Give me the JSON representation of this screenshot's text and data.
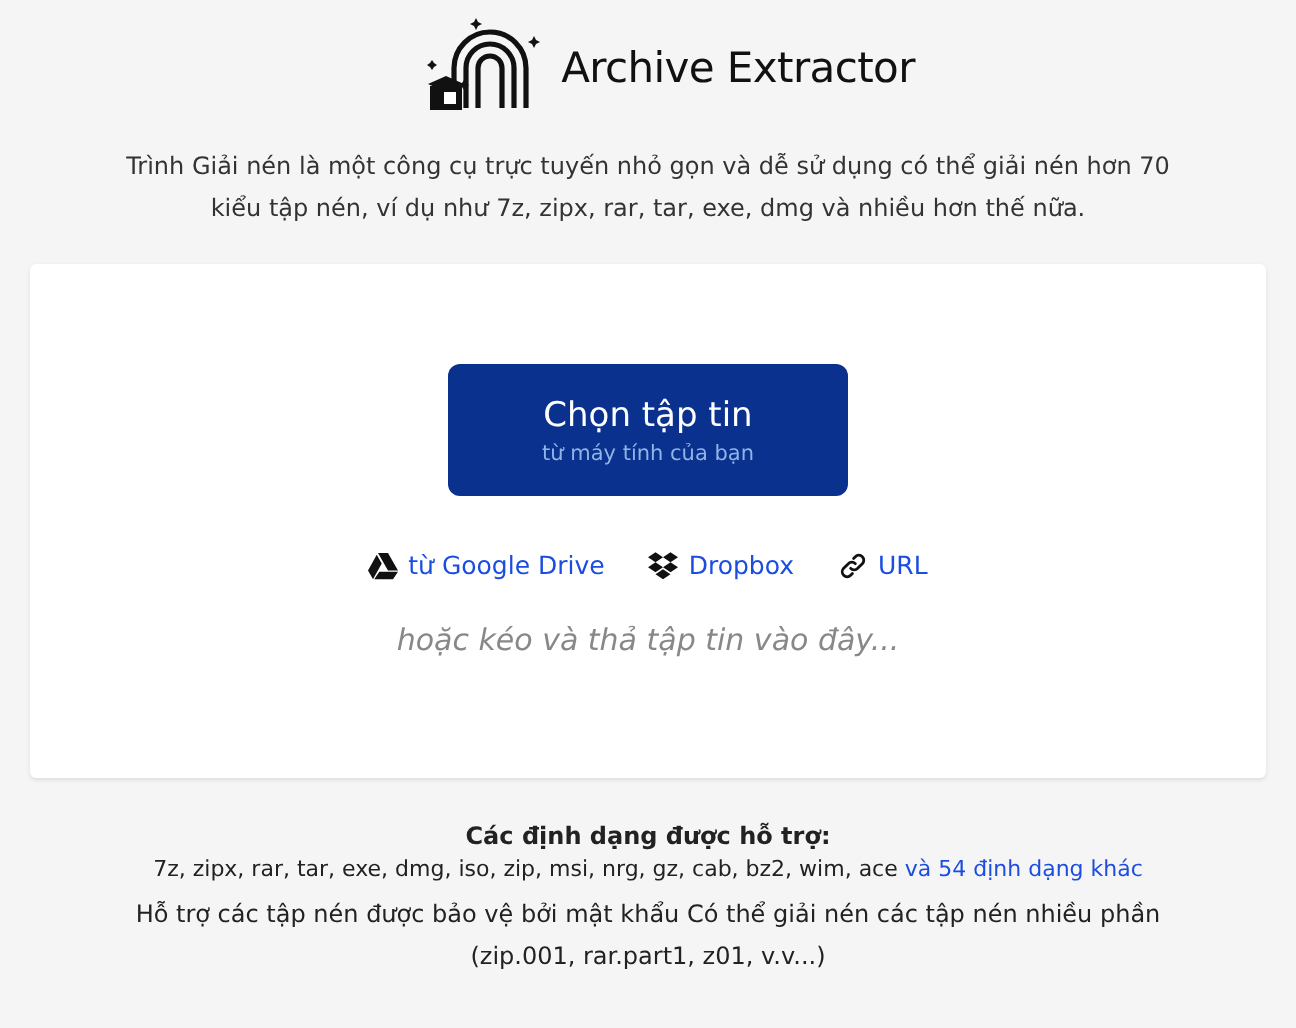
{
  "header": {
    "title": "Archive Extractor",
    "description": "Trình Giải nén là một công cụ trực tuyến nhỏ gọn và dễ sử dụng có thể giải nén hơn 70 kiểu tập nén, ví dụ như 7z, zipx, rar, tar, exe, dmg và nhiều hơn thế nữa."
  },
  "upload": {
    "button": {
      "label": "Chọn tập tin",
      "sublabel": "từ máy tính của bạn"
    },
    "sources": [
      {
        "kind": "drive",
        "label": "từ Google Drive"
      },
      {
        "kind": "dropbox",
        "label": "Dropbox"
      },
      {
        "kind": "url",
        "label": "URL"
      }
    ],
    "drop_hint": "hoặc kéo và thả tập tin vào đây..."
  },
  "formats": {
    "heading": "Các định dạng được hỗ trợ:",
    "list": "7z, zipx, rar, tar, exe, dmg, iso, zip, msi, nrg, gz, cab, bz2, wim, ace",
    "more_link": "và 54 định dạng khác",
    "note": "Hỗ trợ các tập nén được bảo vệ bởi mật khẩu Có thể giải nén các tập nén nhiều phần (zip.001, rar.part1, z01, v.v...)"
  }
}
